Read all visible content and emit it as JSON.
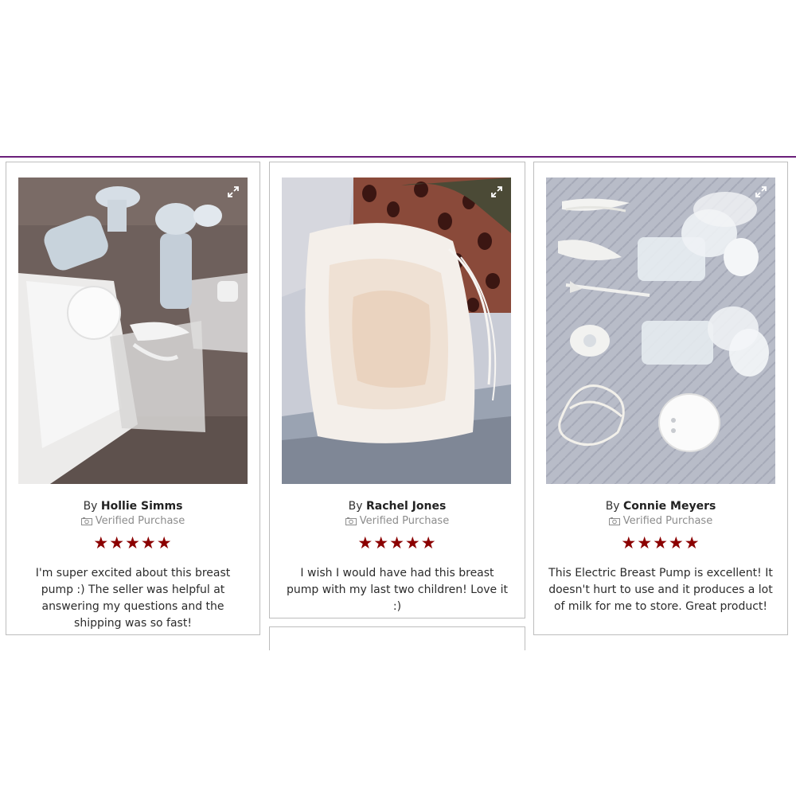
{
  "reviews": [
    {
      "by_prefix": "By",
      "name": "Hollie Simms",
      "verified": "Verified Purchase",
      "stars": "★★★★★",
      "rating": 5,
      "text": "I'm super excited about this breast pump :) The seller was helpful at answering my questions and the shipping was so fast!"
    },
    {
      "by_prefix": "By",
      "name": "Rachel Jones",
      "verified": "Verified Purchase",
      "stars": "★★★★★",
      "rating": 5,
      "text": "I wish I would have had this breast pump with my last two children! Love it :)"
    },
    {
      "by_prefix": "By",
      "name": "Connie Meyers",
      "verified": "Verified Purchase",
      "stars": "★★★★★",
      "rating": 5,
      "text": "This Electric Breast Pump is excellent! It doesn't hurt to use and it produces a lot of milk for me to store. Great product!"
    }
  ],
  "icons": {
    "expand": "expand-icon",
    "verified": "camera-icon",
    "star": "star-icon"
  },
  "colors": {
    "accent_rule": "#6a1f7a",
    "star": "#8b0000",
    "verified_text": "#8c8c8c",
    "card_border": "#bdbdbd"
  }
}
